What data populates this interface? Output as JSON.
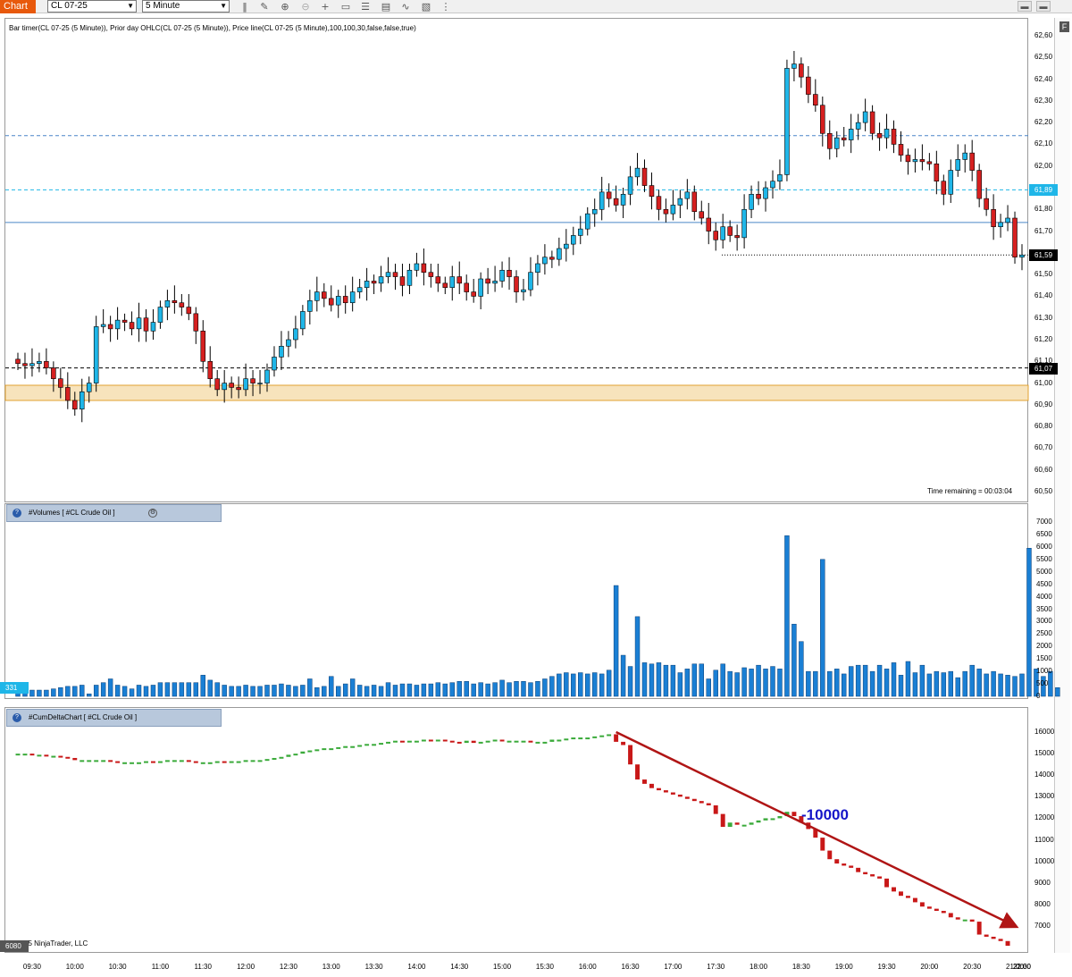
{
  "toolbar": {
    "tab_label": "Chart",
    "instrument": "CL 07-25",
    "interval": "5 Minute",
    "icons": [
      "bar-style-icon",
      "draw-icon",
      "zoom-in-icon",
      "zoom-out-icon",
      "crosshair-icon",
      "data-box-icon",
      "properties-icon",
      "strategies-icon",
      "templates-icon",
      "more-icon"
    ],
    "window_buttons": [
      "window-link-icon",
      "window-menu-icon"
    ]
  },
  "price_panel": {
    "indicator_label": "Bar timer(CL 07-25 (5 Minute)), Prior day OHLC(CL 07-25 (5 Minute)), Price line(CL 07-25 (5 Minute),100,100,30,false,false,true)",
    "time_remaining": "Time remaining = 00:03:04",
    "y_ticks": [
      "62,60",
      "62,50",
      "62,40",
      "62,30",
      "62,20",
      "62,10",
      "62,00",
      "61,90",
      "61,80",
      "61,70",
      "61,60",
      "61,50",
      "61,40",
      "61,30",
      "61,20",
      "61,10",
      "61,00",
      "60,90",
      "60,80",
      "60,70",
      "60,60",
      "60,50"
    ],
    "badges": [
      {
        "label": "61,89",
        "value": 61.89,
        "color": "#1fb6e8"
      },
      {
        "label": "61,59",
        "value": 61.59,
        "color": "#000000"
      },
      {
        "label": "61,07",
        "value": 61.07,
        "color": "#000000"
      }
    ],
    "lines": [
      {
        "value": 62.14,
        "style": "dashed",
        "color": "#4a86c8"
      },
      {
        "value": 61.89,
        "style": "dashed",
        "color": "#1fb6e8"
      },
      {
        "value": 61.74,
        "style": "solid",
        "color": "#4a86c8"
      },
      {
        "value": 61.59,
        "style": "dotted",
        "color": "#000000"
      },
      {
        "value": 61.07,
        "style": "dashed",
        "color": "#000000"
      }
    ],
    "zone": {
      "from": 60.92,
      "to": 60.99,
      "color": "#f7e3bc",
      "border": "#e0a030"
    }
  },
  "volume_panel": {
    "title": "#Volumes   [ #CL Crude Oil ]",
    "y_ticks": [
      "7000",
      "6500",
      "6000",
      "5500",
      "5000",
      "4500",
      "4000",
      "3500",
      "3000",
      "2500",
      "2000",
      "1500",
      "1000",
      "500",
      "0"
    ],
    "badge": {
      "label": "331",
      "color": "#1fb6e8"
    }
  },
  "delta_panel": {
    "title": "#CumDeltaChart   [ #CL Crude Oil ]",
    "y_ticks": [
      "16000",
      "15000",
      "14000",
      "13000",
      "12000",
      "11000",
      "10000",
      "9000",
      "8000",
      "7000"
    ],
    "badge": {
      "label": "6080",
      "color": "#555555"
    },
    "annotation": "-10000",
    "copyright": "© 2025 NinjaTrader, LLC"
  },
  "x_axis": {
    "labels": [
      "09:30",
      "10:00",
      "10:30",
      "11:00",
      "11:30",
      "12:00",
      "12:30",
      "13:00",
      "13:30",
      "14:00",
      "14:30",
      "15:00",
      "15:30",
      "16:00",
      "16:30",
      "17:00",
      "17:30",
      "18:00",
      "18:30",
      "19:00",
      "19:30",
      "20:00",
      "20:30",
      "21:00",
      "21:30",
      "22:00"
    ]
  },
  "colors": {
    "up": "#1fb6e8",
    "down": "#d62020",
    "volume": "#1a7fd4",
    "delta_up": "#3aaa3a",
    "delta_down": "#c81818",
    "trend_arrow": "#b01515"
  },
  "chart_data": [
    {
      "type": "candlestick",
      "title": "CL 07-25 (5 Minute)",
      "ylim": [
        60.5,
        62.6
      ],
      "x_start": "09:20",
      "interval_minutes": 5,
      "close": [
        61.09,
        61.08,
        61.09,
        61.1,
        61.07,
        61.02,
        60.98,
        60.92,
        60.88,
        60.96,
        61.0,
        61.26,
        61.27,
        61.25,
        61.29,
        61.28,
        61.25,
        61.3,
        61.24,
        61.28,
        61.35,
        61.38,
        61.37,
        61.35,
        61.32,
        61.24,
        61.1,
        61.02,
        60.97,
        61.0,
        60.98,
        60.97,
        61.02,
        61.0,
        61.0,
        61.06,
        61.12,
        61.17,
        61.2,
        61.25,
        61.33,
        61.38,
        61.42,
        61.39,
        61.36,
        61.4,
        61.37,
        61.42,
        61.44,
        61.47,
        61.46,
        61.49,
        61.51,
        61.49,
        61.45,
        61.52,
        61.55,
        61.51,
        61.49,
        61.46,
        61.44,
        61.49,
        61.46,
        61.42,
        61.4,
        61.48,
        61.46,
        61.47,
        61.52,
        61.49,
        61.42,
        61.43,
        61.51,
        61.55,
        61.58,
        61.57,
        61.62,
        61.64,
        61.68,
        61.71,
        61.78,
        61.8,
        61.88,
        61.85,
        61.82,
        61.87,
        61.95,
        61.99,
        61.91,
        61.86,
        61.8,
        61.78,
        61.82,
        61.85,
        61.88,
        61.79,
        61.76,
        61.7,
        61.66,
        61.72,
        61.68,
        61.67,
        61.8,
        61.87,
        61.85,
        61.9,
        61.93,
        61.96,
        62.45,
        62.47,
        62.41,
        62.33,
        62.28,
        62.15,
        62.08,
        62.13,
        62.12,
        62.17,
        62.2,
        62.25,
        62.15,
        62.13,
        62.17,
        62.1,
        62.05,
        62.02,
        62.03,
        62.02,
        62.01,
        61.93,
        61.87,
        61.98,
        62.03,
        62.06,
        61.98,
        61.85,
        61.8,
        61.72,
        61.74,
        61.76,
        61.58,
        61.59
      ]
    },
    {
      "type": "bar",
      "title": "#Volumes",
      "ylim": [
        0,
        7000
      ],
      "values": [
        300,
        250,
        250,
        250,
        250,
        300,
        350,
        400,
        400,
        450,
        100,
        450,
        550,
        700,
        450,
        400,
        300,
        450,
        400,
        450,
        550,
        550,
        550,
        550,
        550,
        550,
        850,
        650,
        550,
        450,
        400,
        400,
        450,
        400,
        400,
        450,
        450,
        500,
        450,
        400,
        450,
        700,
        350,
        400,
        800,
        400,
        500,
        700,
        450,
        400,
        450,
        400,
        550,
        450,
        500,
        500,
        450,
        500,
        500,
        550,
        500,
        550,
        600,
        600,
        500,
        550,
        500,
        550,
        650,
        550,
        600,
        600,
        550,
        600,
        700,
        800,
        900,
        950,
        900,
        950,
        900,
        950,
        900,
        1050,
        4450,
        1650,
        1200,
        3200,
        1350,
        1300,
        1350,
        1250,
        1250,
        950,
        1100,
        1300,
        1300,
        700,
        1050,
        1300,
        1000,
        950,
        1150,
        1100,
        1250,
        1100,
        1200,
        1100,
        6450,
        2900,
        2200,
        1000,
        1000,
        5500,
        1000,
        1100,
        900,
        1200,
        1250,
        1250,
        1000,
        1250,
        1100,
        1350,
        850,
        1400,
        950,
        1250,
        900,
        1000,
        950,
        1000,
        750,
        1000,
        1250,
        1100,
        900,
        1000,
        900,
        850,
        800,
        900,
        5950,
        1100,
        800,
        1000,
        350
      ]
    },
    {
      "type": "line",
      "title": "#CumDeltaChart",
      "ylim": [
        6000,
        16500
      ],
      "values": [
        15000,
        15000,
        14950,
        14950,
        14900,
        14900,
        14850,
        14800,
        14700,
        14700,
        14700,
        14700,
        14700,
        14650,
        14600,
        14600,
        14600,
        14600,
        14650,
        14600,
        14650,
        14700,
        14700,
        14700,
        14650,
        14600,
        14600,
        14600,
        14650,
        14600,
        14650,
        14650,
        14700,
        14700,
        14700,
        14750,
        14800,
        14850,
        14950,
        15000,
        15100,
        15150,
        15200,
        15250,
        15250,
        15300,
        15350,
        15350,
        15400,
        15450,
        15450,
        15500,
        15550,
        15600,
        15550,
        15600,
        15600,
        15650,
        15600,
        15650,
        15600,
        15550,
        15500,
        15600,
        15500,
        15550,
        15600,
        15650,
        15600,
        15600,
        15600,
        15600,
        15550,
        15550,
        15550,
        15650,
        15650,
        15700,
        15750,
        15750,
        15750,
        15800,
        15850,
        15900,
        15550,
        15400,
        14500,
        13800,
        13600,
        13400,
        13300,
        13200,
        13100,
        13000,
        12900,
        12800,
        12700,
        12600,
        12200,
        11600,
        11800,
        11700,
        11700,
        11800,
        11900,
        12000,
        12000,
        12100,
        12300,
        12100,
        11800,
        11500,
        11100,
        10500,
        10100,
        9900,
        9800,
        9700,
        9500,
        9400,
        9300,
        9200,
        8800,
        8600,
        8400,
        8300,
        8100,
        7900,
        7800,
        7700,
        7600,
        7400,
        7300,
        7300,
        7200,
        6600,
        6500,
        6400,
        6300,
        6080
      ]
    }
  ]
}
